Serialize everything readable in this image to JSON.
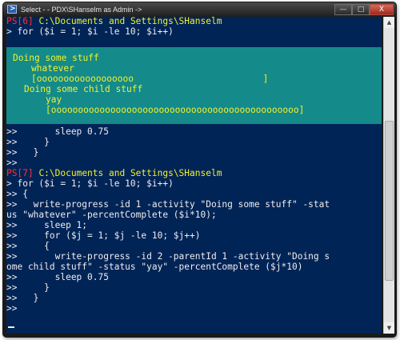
{
  "window": {
    "title": "Select - - PDX\\SHanselm as Admin ->",
    "buttons": {
      "minimize": "—",
      "maximize": "□",
      "close": "X"
    }
  },
  "console": {
    "prompt1": {
      "ps": "PS[6]",
      "path": "C:\\Documents and Settings\\SHanselm",
      "command": "> for ($i = 1; $i -le 10; $i++)"
    },
    "progress": {
      "activity": "Doing some stuff",
      "status": "whatever",
      "bar": "[oooooooooooooooooo                        ]",
      "child_activity": "Doing some child stuff",
      "child_status": "yay",
      "child_bar": "[oooooooooooooooooooooooooooooooooooooooooooooo]"
    },
    "lines_after_progress": [
      ">>       sleep 0.75",
      ">>     }",
      ">>   }",
      ">>"
    ],
    "prompt2": {
      "ps": "PS[7]",
      "path": "C:\\Documents and Settings\\SHanselm",
      "command": "> for ($i = 1; $i -le 10; $i++)"
    },
    "lines_after_prompt2": [
      ">> {",
      ">>   write-progress -id 1 -activity \"Doing some stuff\" -stat",
      "us \"whatever\" -percentComplete ($i*10);",
      ">>     sleep 1;",
      ">>     for ($j = 1; $j -le 10; $j++)",
      ">>     {",
      ">>       write-progress -id 2 -parentId 1 -activity \"Doing s",
      "ome child stuff\" -status \"yay\" -percentComplete ($j*10)",
      ">>       sleep 0.75",
      ">>     }",
      ">>   }",
      ">>"
    ]
  }
}
